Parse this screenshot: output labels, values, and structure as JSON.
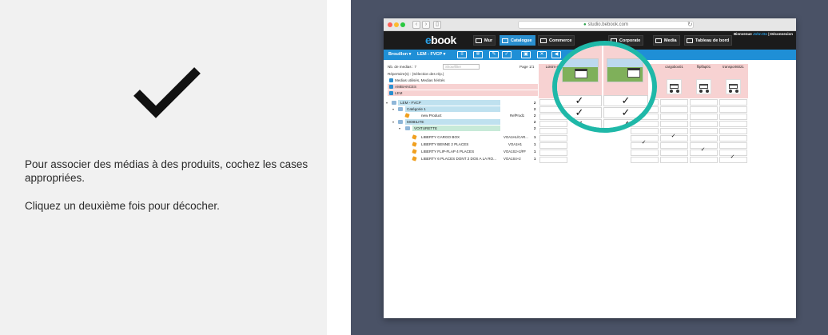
{
  "instructions": {
    "line1": "Pour associer des médias à des produits,  cochez les cases appropriées.",
    "line2": "Cliquez un deuxième fois pour décocher."
  },
  "browser": {
    "url": "studio.bebook.com"
  },
  "app": {
    "logo_prefix": "",
    "logo_rest": "book",
    "nav": [
      {
        "label": "Mur",
        "icon": "wall-icon"
      },
      {
        "label": "Catalogue",
        "icon": "catalog-icon",
        "active": true
      },
      {
        "label": "Commerce",
        "icon": "commerce-icon"
      },
      {
        "label": "Corporate",
        "icon": "corporate-icon"
      },
      {
        "label": "Media",
        "icon": "media-icon"
      },
      {
        "label": "Tableau de bord",
        "icon": "dashboard-icon"
      }
    ],
    "welcome": "Bienvenue",
    "user": "John Do",
    "logout": "Déconnexion"
  },
  "toolbar": {
    "draft": "Brouillon ▾",
    "catalog": "LEM - FVCP ▾"
  },
  "sidebar": {
    "media_count": "Nb. de medias : 7",
    "filter_placeholder": "Show/filter",
    "page": "Page 1/1",
    "directories": "Répertoire(s) : (Sélection des rép.)",
    "checks": [
      "Medias utilisés, Medias hérités",
      "AMBIANCES",
      "LEM"
    ]
  },
  "tree": [
    {
      "label": "LEM - FVCP",
      "count": "2"
    },
    {
      "label": "Catégorie 1",
      "count": "2"
    },
    {
      "label": "new Product",
      "ref": "RefProd1",
      "count": "2"
    },
    {
      "label": "MOBILITE",
      "count": "2"
    },
    {
      "label": "VOITURETTE",
      "count": "2"
    },
    {
      "label": "LIBERTY CARGO BOX",
      "ref": "VOA1HL/CAR...",
      "count": "1"
    },
    {
      "label": "LIBERTY BENNE 2 PLACES",
      "ref": "VOA1H1",
      "count": "1"
    },
    {
      "label": "LIBERTY FLIP-FLAP 4 PLACES",
      "ref": "VOA1S2+2/FF",
      "count": "1"
    },
    {
      "label": "LIBERTY 6 PLACES DONT 2 DOS A LA RO...",
      "ref": "VOA1S4+2",
      "count": "1"
    }
  ],
  "grid": {
    "columns": [
      "Loisirs-4...",
      "",
      "",
      "benne-...",
      "cargobox01",
      "flipflap01",
      "transport6021"
    ],
    "zoom_checks": [
      "✓",
      "✓",
      "✓",
      "✓",
      "✓",
      "✓"
    ],
    "row_checks": [
      "✓",
      "✓",
      "✓",
      "✓"
    ]
  }
}
